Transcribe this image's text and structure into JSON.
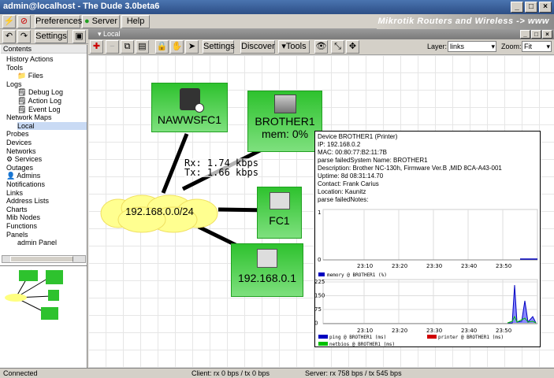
{
  "window": {
    "title": "admin@localhost - The Dude 3.0beta6"
  },
  "brand": {
    "text": "Mikrotik Routers and Wireless -> www"
  },
  "toolbar1": {
    "preferences": "Preferences",
    "server": "Server",
    "help": "Help"
  },
  "toolbar2": {
    "settings": "Settings"
  },
  "mapbar": {
    "title": "Local"
  },
  "maptoolbar": {
    "settings": "Settings",
    "discover": "Discover",
    "tools": "Tools",
    "layer_label": "Layer:",
    "layer_value": "links",
    "zoom_label": "Zoom:",
    "zoom_value": "Fit"
  },
  "sidebar": {
    "header": "Contents",
    "items": [
      "History Actions",
      "Tools",
      "Files",
      "Logs",
      "Debug Log",
      "Action Log",
      "Event Log",
      "Network Maps",
      "Local",
      "Probes",
      "Devices",
      "Networks",
      "Services",
      "Outages",
      "Admins",
      "Notifications",
      "Links",
      "Address Lists",
      "Charts",
      "Mib Nodes",
      "Functions",
      "Panels",
      "admin Panel"
    ]
  },
  "map": {
    "nodes": [
      {
        "name": "NAWWSFC1"
      },
      {
        "name": "BROTHER1",
        "sub": "mem: 0%"
      },
      {
        "name": "FC1"
      },
      {
        "name": "192.168.0.1"
      }
    ],
    "network": "192.168.0.0/24",
    "traffic": {
      "rx": "Rx: 1.74 kbps",
      "tx": "Tx: 1.66 kbps"
    }
  },
  "tooltip": {
    "lines": [
      "Device BROTHER1 (Printer)",
      "IP: 192.168.0.2",
      "MAC: 00:80:77:B2:11:7B",
      "parse failedSystem Name: BROTHER1",
      "Description: Brother NC-130h, Firmware Ver.B  ,MID 8CA-A43-001",
      "Uptime: 8d 08:31:14.70",
      "Contact: Frank Carius",
      "Location: Kaunitz",
      "parse failedNotes:"
    ],
    "chart1_ymax": "1",
    "chart1_ymin": "0",
    "chart2_yticks": [
      "225",
      "150",
      "75",
      "0"
    ],
    "xticks": [
      "23:10",
      "23:20",
      "23:30",
      "23:40",
      "23:50"
    ],
    "legend": {
      "memory": "memory @ BROTHER1 (%)",
      "ping": "ping @ BROTHER1 (ms)",
      "printer": "printer @ BROTHER1 (ms)",
      "netbios": "netbios @ BROTHER1 (ms)"
    },
    "colors": {
      "memory": "#0000c0",
      "ping": "#0000c0",
      "printer": "#d00000",
      "netbios": "#00c000"
    }
  },
  "status": {
    "left": "Connected",
    "client": "Client: rx 0 bps / tx 0 bps",
    "server": "Server: rx 758 bps / tx 545 bps"
  }
}
